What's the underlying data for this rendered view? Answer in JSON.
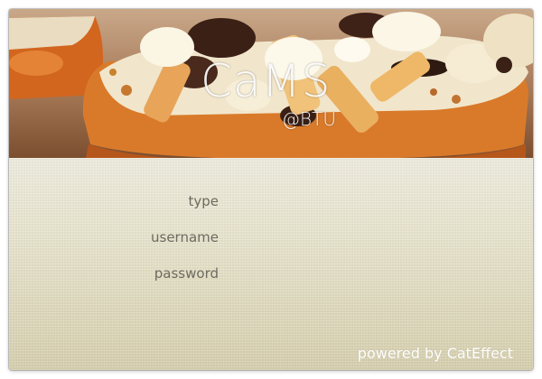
{
  "app": {
    "title": "CaMS",
    "subtitle": "@BTU"
  },
  "banner": {
    "image": "pizza-photo"
  },
  "form": {
    "fields": [
      {
        "label": "type",
        "value": "",
        "placeholder": ""
      },
      {
        "label": "username",
        "value": "",
        "placeholder": ""
      },
      {
        "label": "password",
        "value": "",
        "placeholder": ""
      }
    ]
  },
  "footer": {
    "prefix": "powered by ",
    "brand": "CatEffect"
  },
  "colors": {
    "label_text": "#6d6a60",
    "footer_text": "#ffffff",
    "background_light": "#f0eedf",
    "background_dark": "#d8d1af"
  }
}
